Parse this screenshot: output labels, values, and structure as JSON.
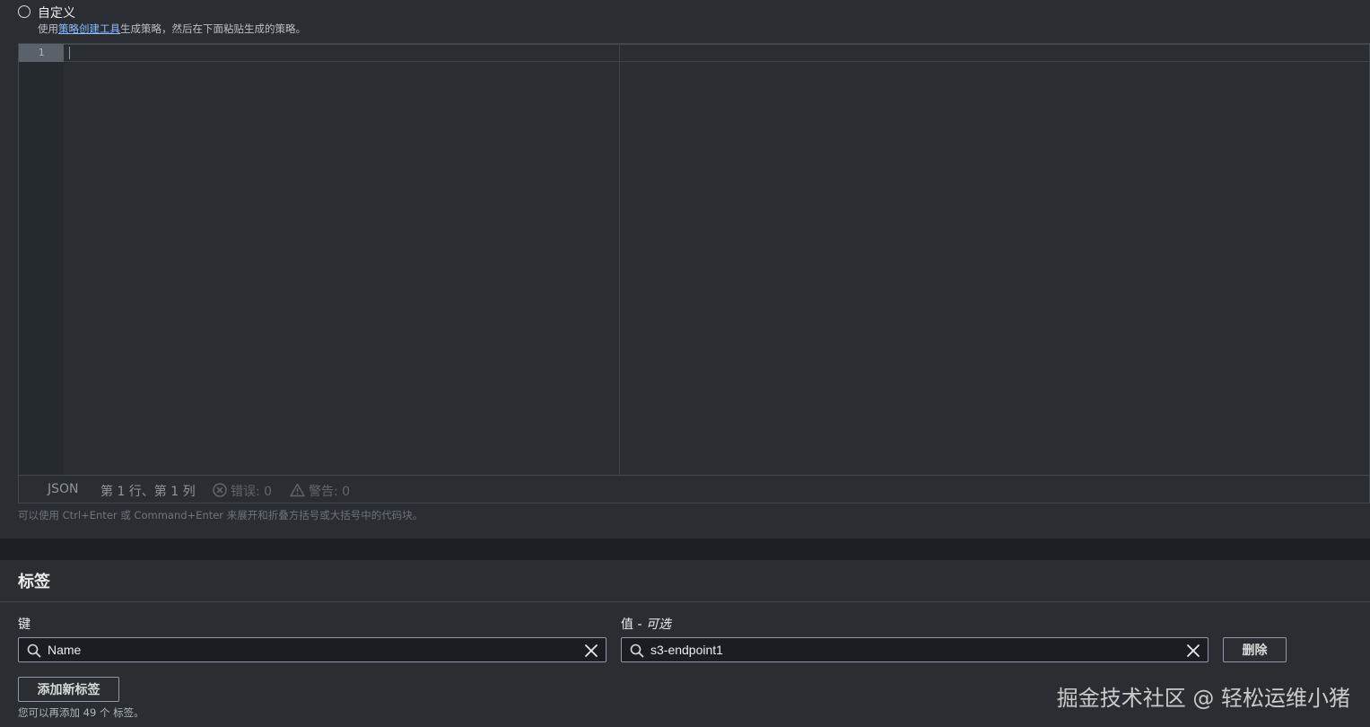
{
  "policy": {
    "option_label": "自定义",
    "desc_prefix": "使用",
    "desc_link": "策略创建工具",
    "desc_suffix": "生成策略，然后在下面粘贴生成的策略。",
    "editor": {
      "line_number": "1",
      "content": ""
    },
    "status": {
      "language": "JSON",
      "position": "第 1 行、第 1 列",
      "errors": "错误: 0",
      "warnings": "警告: 0"
    },
    "hint": "可以使用 Ctrl+Enter 或 Command+Enter 来展开和折叠方括号或大括号中的代码块。"
  },
  "tags": {
    "title": "标签",
    "key_label": "键",
    "value_label": "值",
    "value_optional": "可选",
    "value_separator": " - ",
    "key_value": "Name",
    "value_value": "s3-endpoint1",
    "delete_label": "删除",
    "add_label": "添加新标签",
    "remaining_note": "您可以再添加 49 个 标签。"
  },
  "watermark": "掘金技术社区 @ 轻松运维小猪",
  "icons": {
    "search": "search-icon",
    "clear": "close-icon",
    "error": "error-circle-icon",
    "warning": "warning-triangle-icon"
  }
}
